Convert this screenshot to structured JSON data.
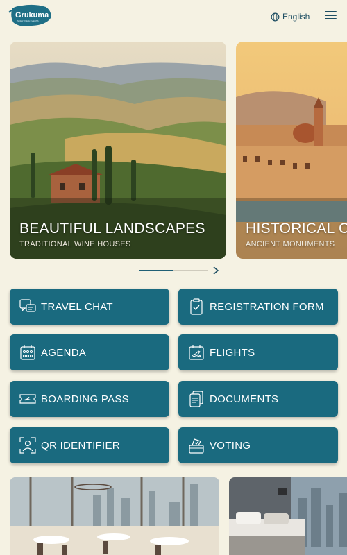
{
  "header": {
    "logo_text": "Grukuma",
    "logo_tagline": "INCENTIVE & EVENTS",
    "language": "English"
  },
  "carousel": {
    "slides": [
      {
        "title": "BEAUTIFUL LANDSCAPES",
        "subtitle": "TRADITIONAL WINE HOUSES"
      },
      {
        "title": "HISTORICAL C",
        "subtitle": "ANCIENT MONUMENTS"
      }
    ],
    "progress": 0.5
  },
  "menu": {
    "travel_chat": "TRAVEL CHAT",
    "registration_form": "REGISTRATION FORM",
    "agenda": "AGENDA",
    "flights": "FLIGHTS",
    "boarding_pass": "BOARDING PASS",
    "documents": "DOCUMENTS",
    "qr_identifier": "QR IDENTIFIER",
    "voting": "VOTING"
  },
  "colors": {
    "background": "#f5f2e3",
    "tile": "#1a6a7f",
    "accent": "#1f4f63"
  }
}
